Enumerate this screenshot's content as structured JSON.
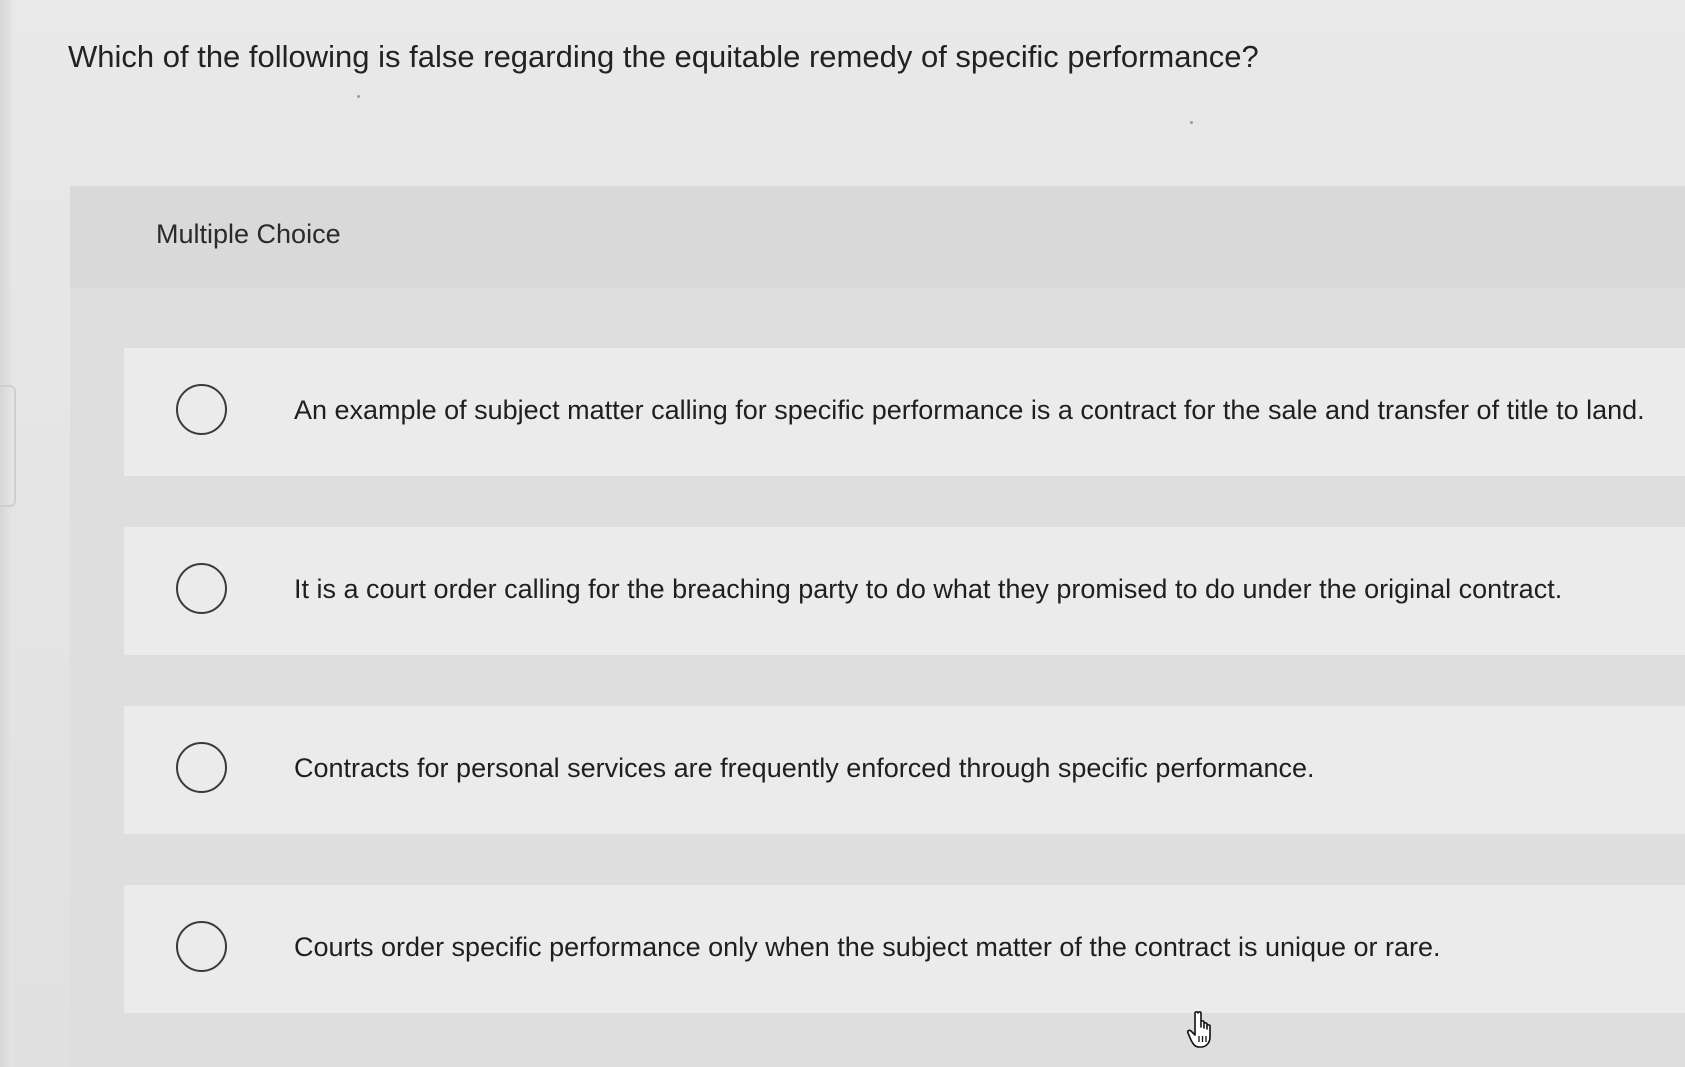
{
  "question": {
    "text": "Which of the following is false regarding the equitable remedy of specific performance?"
  },
  "panel": {
    "title": "Multiple Choice"
  },
  "options": [
    {
      "text": "An example of subject matter calling for specific performance is a contract for the sale and transfer of title to land."
    },
    {
      "text": "It is a court order calling for the breaching party to do what they promised to do under the original contract."
    },
    {
      "text": "Contracts for personal services are frequently enforced through specific performance."
    },
    {
      "text": "Courts order specific performance only when the subject matter of the contract is unique or rare."
    }
  ],
  "icons": {
    "radio": "radio-circle-icon",
    "cursor": "hand-pointer-icon"
  }
}
